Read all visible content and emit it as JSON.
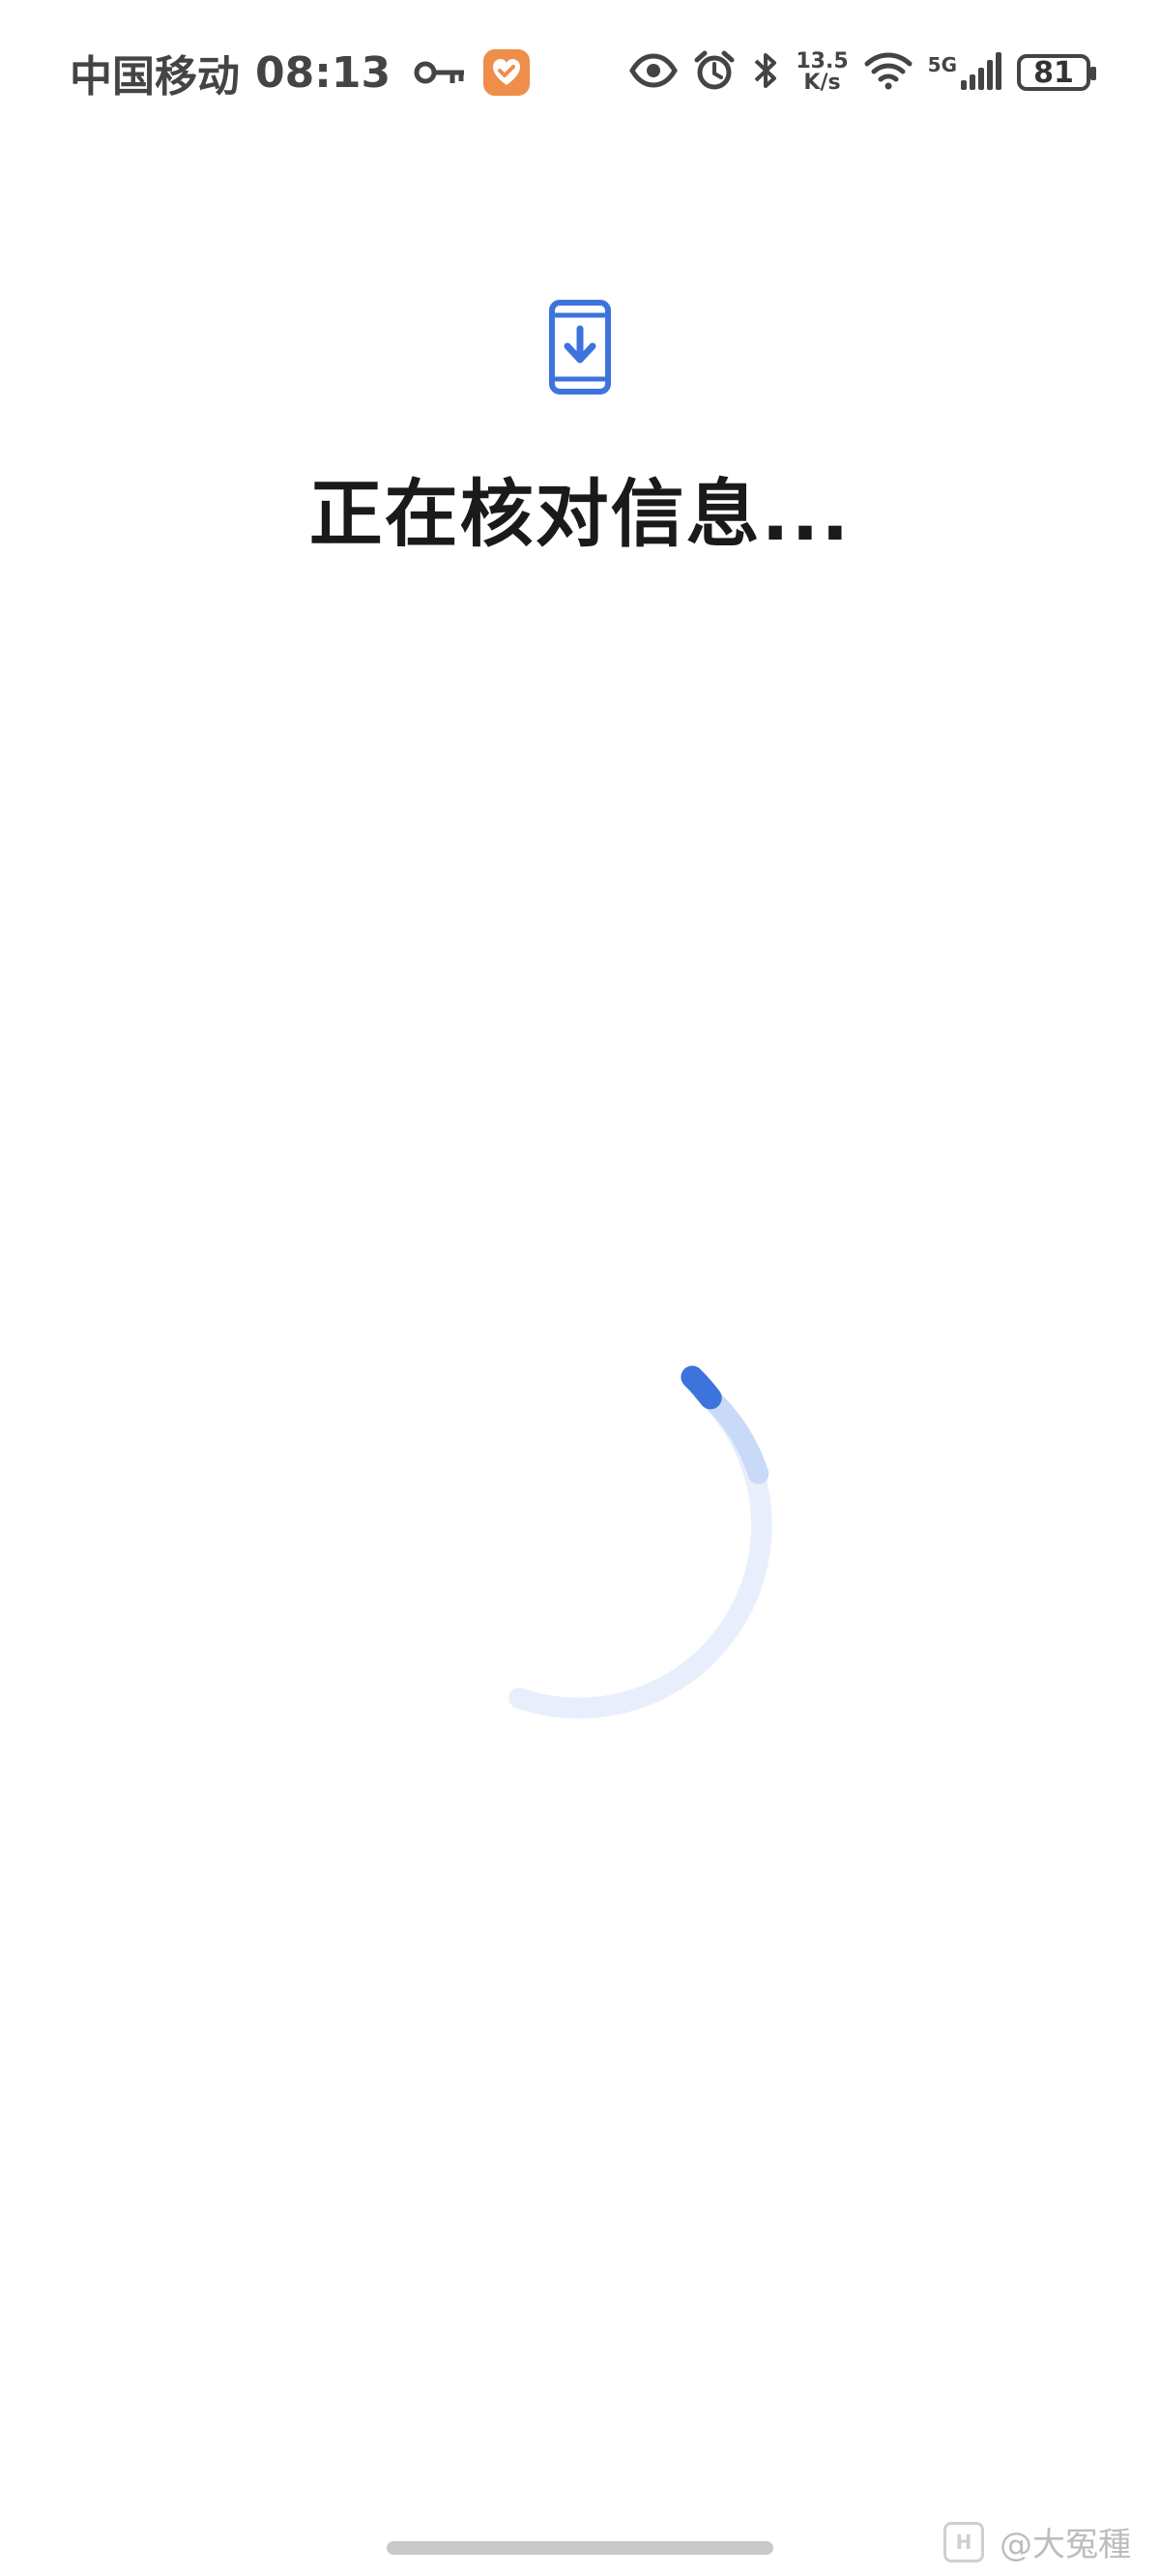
{
  "status_bar": {
    "carrier": "中国移动",
    "time": "08:13",
    "speed_value": "13.5",
    "speed_unit": "K/s",
    "network_label": "5G",
    "battery": "81",
    "icons": [
      "key-icon",
      "app-notification-icon",
      "eye-icon",
      "alarm-icon",
      "bluetooth-icon",
      "wifi-icon",
      "signal-icon",
      "battery-icon"
    ]
  },
  "main": {
    "icon": "phone-download-icon",
    "title": "正在核对信息...",
    "progress_indicator": "loading-spinner"
  },
  "watermark": {
    "text": "@大冤種"
  },
  "colors": {
    "accent": "#3d73dc",
    "spinner_track": "#e8eefb",
    "spinner_mid": "#c9daf8"
  }
}
